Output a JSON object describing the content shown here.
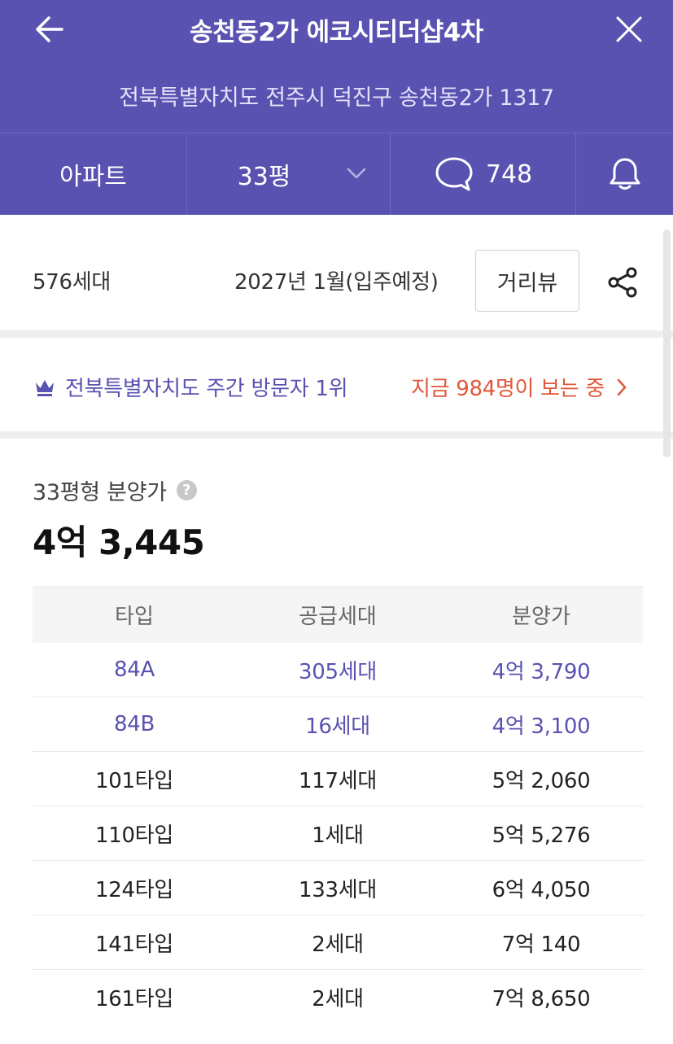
{
  "header": {
    "title": "송천동2가 에코시티더샵4차",
    "address": "전북특별자치도 전주시 덕진구 송천동2가 1317",
    "bg_color": "#5a52b0"
  },
  "tabs": {
    "type_label": "아파트",
    "size_label": "33평",
    "comment_count": "748"
  },
  "info": {
    "units": "576세대",
    "move_in": "2027년 1월(입주예정)",
    "street_view_label": "거리뷰"
  },
  "rank": {
    "text": "전북특별자치도 주간 방문자 1위",
    "viewers_text": "지금 984명이 보는 중",
    "accent_color": "#5a52b0",
    "viewers_color": "#e0573b"
  },
  "price": {
    "label": "33평형 분양가",
    "value": "4억 3,445"
  },
  "table": {
    "headers": [
      "타입",
      "공급세대",
      "분양가"
    ],
    "rows": [
      {
        "type": "84A",
        "units": "305세대",
        "price": "4억 3,790",
        "highlight": true
      },
      {
        "type": "84B",
        "units": "16세대",
        "price": "4억 3,100",
        "highlight": true
      },
      {
        "type": "101타입",
        "units": "117세대",
        "price": "5억 2,060",
        "highlight": false
      },
      {
        "type": "110타입",
        "units": "1세대",
        "price": "5억 5,276",
        "highlight": false
      },
      {
        "type": "124타입",
        "units": "133세대",
        "price": "6억 4,050",
        "highlight": false
      },
      {
        "type": "141타입",
        "units": "2세대",
        "price": "7억 140",
        "highlight": false
      },
      {
        "type": "161타입",
        "units": "2세대",
        "price": "7억 8,650",
        "highlight": false
      }
    ]
  }
}
